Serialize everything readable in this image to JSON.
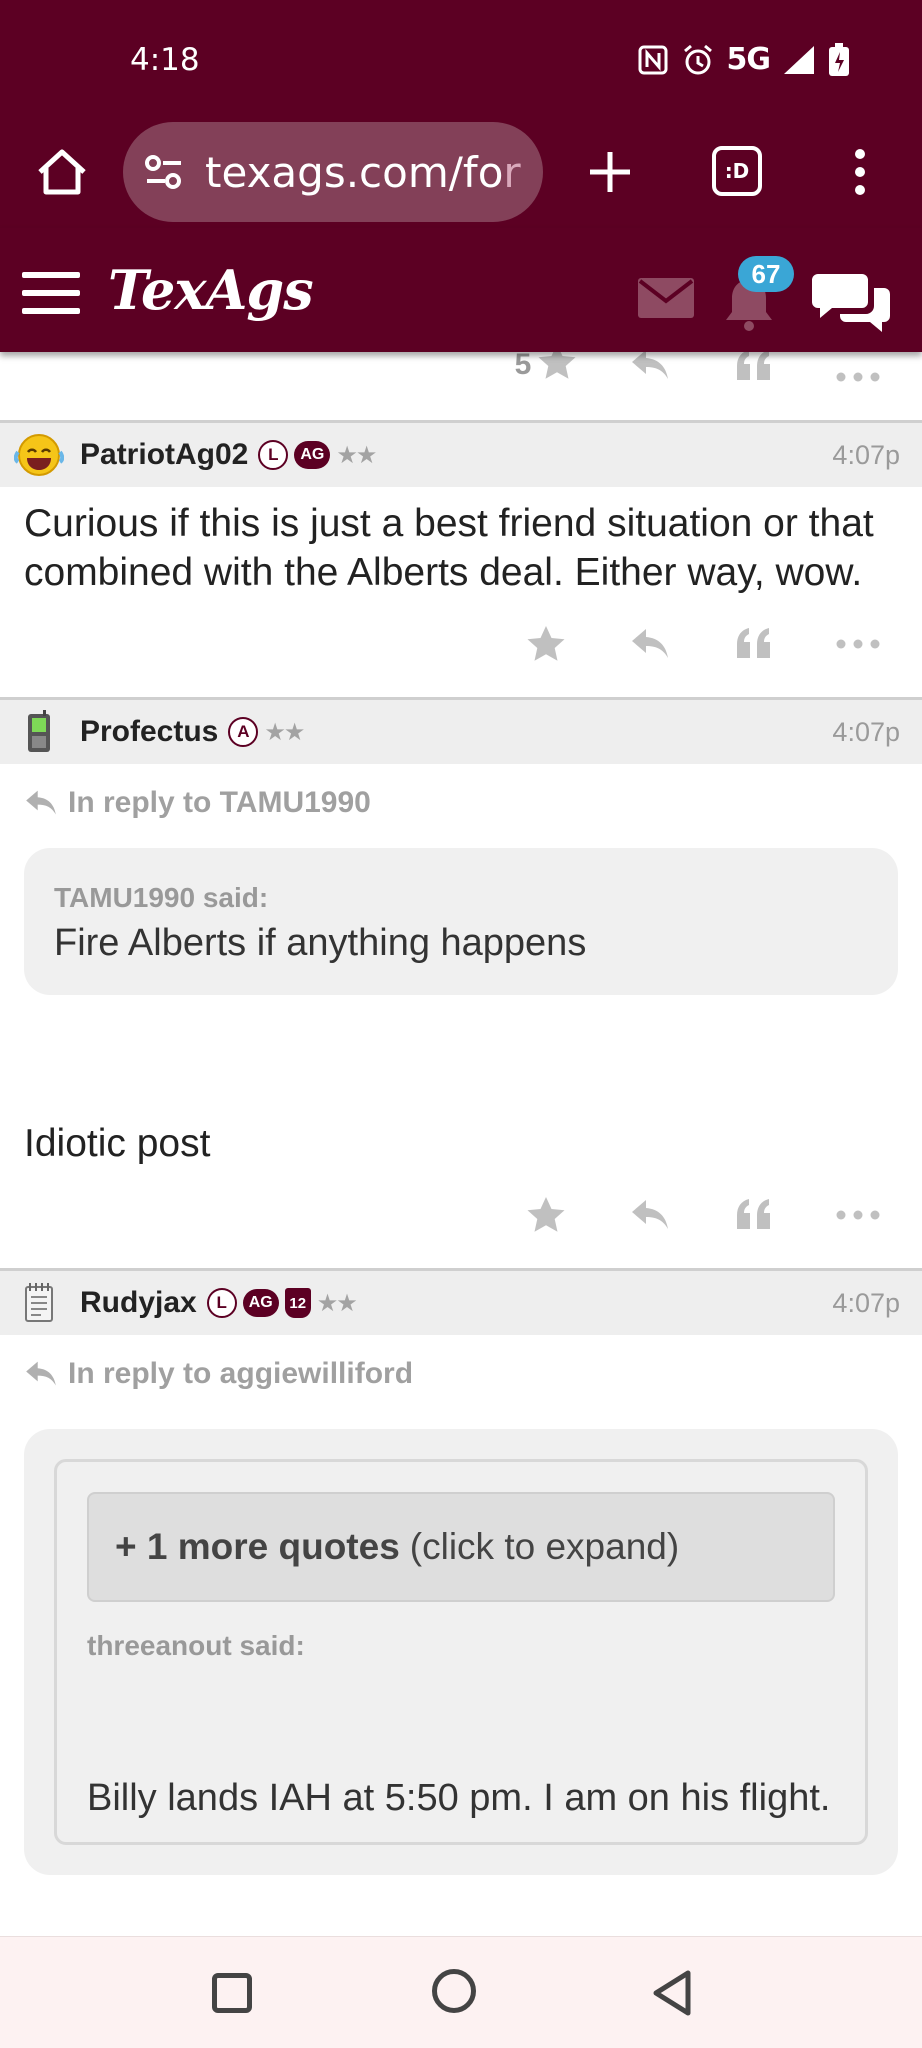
{
  "status_bar": {
    "time": "4:18",
    "network": "5G"
  },
  "browser": {
    "url_main": "texags.com/fo",
    "url_fade": "r",
    "tab_label": ":D"
  },
  "site_header": {
    "logo": "TexAgs",
    "notification_count": "67",
    "brand_color": "#5c0023",
    "badge_color": "#3aa6d6"
  },
  "top_actions": {
    "star_count": "5"
  },
  "posts": [
    {
      "username": "PatriotAg02",
      "badges": [
        "L",
        "AG"
      ],
      "stars": "★★",
      "time": "4:07p",
      "avatar_icon": "laughing-emoji-icon",
      "body": "Curious if this is just a best friend situation or that combined with the Alberts deal. Either way, wow."
    },
    {
      "username": "Profectus",
      "badges": [
        "A"
      ],
      "stars": "★★",
      "time": "4:07p",
      "avatar_icon": "phone-icon",
      "reply_to": "In reply to TAMU1990",
      "quote_said": "TAMU1990 said:",
      "quote_text": "Fire Alberts if anything happens",
      "body": "Idiotic post"
    },
    {
      "username": "Rudyjax",
      "badges": [
        "L",
        "AG",
        "12"
      ],
      "stars": "★★",
      "time": "4:07p",
      "avatar_icon": "notepad-icon",
      "reply_to": "In reply to aggiewilliford",
      "expand_bold": "+ 1 more quotes",
      "expand_rest": "(click to expand)",
      "inner_said": "threeanout said:",
      "inner_text": "Billy lands IAH at 5:50 pm. I am on his flight."
    }
  ]
}
